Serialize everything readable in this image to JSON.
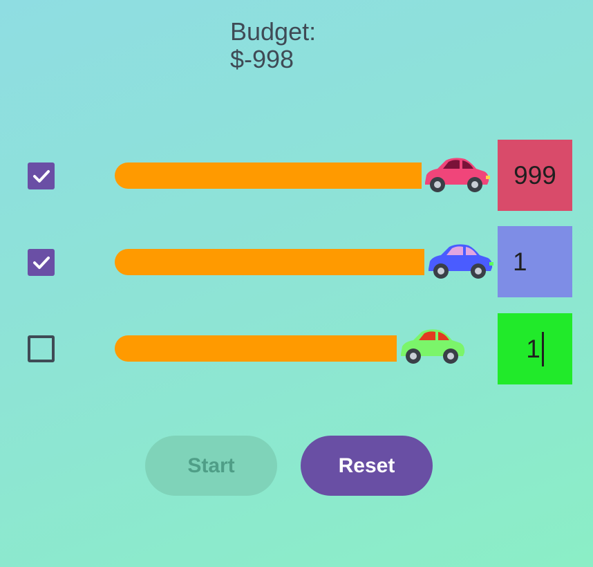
{
  "budget": {
    "label": "Budget:",
    "value": "$-998"
  },
  "rows": [
    {
      "checked": true,
      "bar_progress": 0.86,
      "car_color": "#f0457a",
      "box_color": "#d94b6a",
      "amount": "999"
    },
    {
      "checked": true,
      "bar_progress": 0.87,
      "car_color": "#4a5cff",
      "box_color": "#7e8de6",
      "amount": "1"
    },
    {
      "checked": false,
      "bar_progress": 0.79,
      "car_color": "#7bf56a",
      "box_color": "#21ea2a",
      "amount": "1"
    }
  ],
  "buttons": {
    "start": "Start",
    "reset": "Reset"
  },
  "colors": {
    "bar": "#ff9a00",
    "accent": "#6a4fa5"
  }
}
